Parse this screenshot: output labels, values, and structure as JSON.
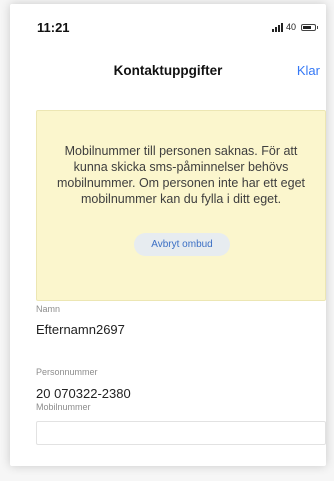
{
  "status_bar": {
    "time": "11:21",
    "signal_text": "40"
  },
  "nav": {
    "title": "Kontaktuppgifter",
    "done_label": "Klar"
  },
  "notice": {
    "message": "Mobilnummer till personen saknas. För att kunna skicka sms-påminnelser behövs mobilnummer. Om personen inte har ett eget mobilnummer kan du fylla i ditt eget.",
    "cancel_label": "Avbryt ombud",
    "background_color": "#fbf6cd"
  },
  "fields": {
    "name_label": "Namn",
    "name_value": "Efternamn2697",
    "personal_number_label": "Personnummer",
    "personal_number_value": "20 070322-2380",
    "mobile_label": "Mobilnummer",
    "mobile_value": ""
  },
  "colors": {
    "accent": "#3478f6"
  }
}
